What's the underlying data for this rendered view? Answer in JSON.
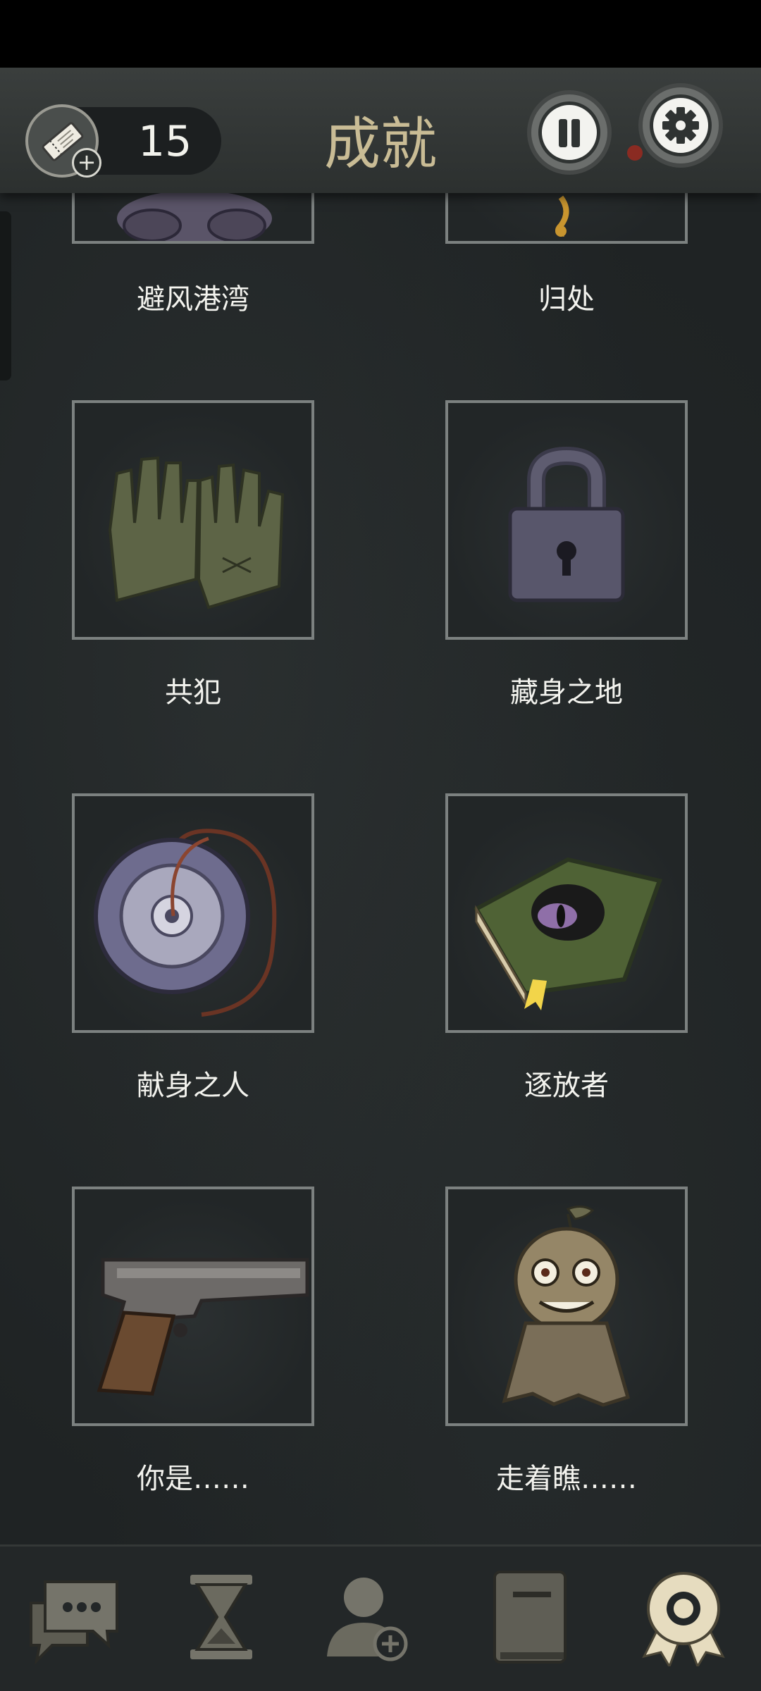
{
  "header": {
    "title": "成就",
    "ticket_count": "15",
    "ticket_icon": "ticket-icon",
    "pause_icon": "pause-icon",
    "settings_icon": "gear-icon"
  },
  "achievements": [
    {
      "label": "避风港湾",
      "icon": "creature-icon"
    },
    {
      "label": "归处",
      "icon": "pendant-icon"
    },
    {
      "label": "共犯",
      "icon": "gloves-icon"
    },
    {
      "label": "藏身之地",
      "icon": "padlock-icon"
    },
    {
      "label": "献身之人",
      "icon": "amulet-icon"
    },
    {
      "label": "逐放者",
      "icon": "eye-book-icon"
    },
    {
      "label": "你是……",
      "icon": "pistol-icon"
    },
    {
      "label": "走着瞧……",
      "icon": "ghost-doll-icon"
    }
  ],
  "bottom_nav": [
    {
      "name": "chat-icon",
      "active": false
    },
    {
      "name": "hourglass-icon",
      "active": false
    },
    {
      "name": "add-user-icon",
      "active": false
    },
    {
      "name": "book-icon",
      "active": false
    },
    {
      "name": "achievement-ribbon-icon",
      "active": true
    }
  ],
  "colors": {
    "title": "#c9bc95",
    "nav_active": "#e6dcbf",
    "nav_inactive": "#6b6a5f",
    "background": "#1f2324"
  }
}
